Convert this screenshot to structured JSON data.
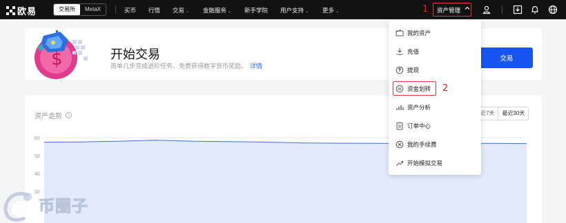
{
  "nav": {
    "logo_text": "欧易",
    "segment": [
      "交易所",
      "MetaX"
    ],
    "items": [
      {
        "label": "买币",
        "chevron": false
      },
      {
        "label": "行情",
        "chevron": false
      },
      {
        "label": "交易",
        "chevron": true
      },
      {
        "label": "金融服务",
        "chevron": true
      },
      {
        "label": "新手学院",
        "chevron": false
      },
      {
        "label": "用户支持",
        "chevron": true
      },
      {
        "label": "更多",
        "chevron": true
      }
    ],
    "asset_menu_label": "资产管理",
    "step1": "1",
    "icons": [
      "user-icon",
      "download-icon",
      "bell-icon",
      "globe-icon"
    ]
  },
  "hero": {
    "title": "开始交易",
    "subtitle": "简单几步完成进阶任务，免费获得数字货币奖励。",
    "link": "详情",
    "button": "交易"
  },
  "chart": {
    "title": "资产走势",
    "range_options": [
      "近7天",
      "最近30天"
    ],
    "active_range": "最近30天"
  },
  "chart_data": {
    "type": "area",
    "yticks": [
      60,
      50,
      40,
      30
    ],
    "values": [
      57.5,
      57.6,
      58.0,
      58.6,
      58.0,
      57.8,
      57.5,
      57.0,
      56.9,
      56.8,
      56.7,
      56.7,
      56.8,
      56.7
    ],
    "ylim": [
      20,
      62
    ],
    "line_color": "#3b6fe0",
    "fill_color": "#dbe5fb"
  },
  "dropdown": {
    "items": [
      {
        "label": "我的资产",
        "icon": "wallet-icon"
      },
      {
        "label": "充值",
        "icon": "deposit-icon"
      },
      {
        "label": "提现",
        "icon": "withdraw-icon"
      },
      {
        "label": "资金划转",
        "icon": "transfer-icon"
      },
      {
        "label": "资产分析",
        "icon": "analysis-icon"
      },
      {
        "label": "订单中心",
        "icon": "order-icon"
      },
      {
        "label": "我的手续费",
        "icon": "fee-icon"
      },
      {
        "label": "开始模拟交易",
        "icon": "demo-trading-icon"
      }
    ],
    "step2": "2"
  },
  "watermark": {
    "text": "币圈子"
  }
}
